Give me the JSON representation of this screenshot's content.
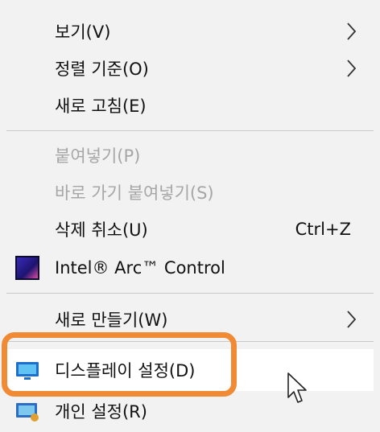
{
  "menu": {
    "items": [
      {
        "label": "보기(V)",
        "has_submenu": true
      },
      {
        "label": "정렬 기준(O)",
        "has_submenu": true
      },
      {
        "label": "새로 고침(E)"
      },
      {
        "label": "붙여넣기(P)",
        "disabled": true
      },
      {
        "label": "바로 가기 붙여넣기(S)",
        "disabled": true
      },
      {
        "label": "삭제 취소(U)",
        "shortcut": "Ctrl+Z"
      },
      {
        "label": "Intel® Arc™ Control",
        "icon": "intel-arc-icon"
      },
      {
        "label": "새로 만들기(W)",
        "has_submenu": true
      },
      {
        "label": "디스플레이 설정(D)",
        "icon": "display-icon",
        "hovered": true
      },
      {
        "label": "개인 설정(R)",
        "icon": "personalize-icon"
      }
    ]
  },
  "colors": {
    "background": "#f2f2f2",
    "hover": "#ffffff",
    "highlight_border": "#f08a34",
    "disabled_text": "#a6a6a6"
  }
}
